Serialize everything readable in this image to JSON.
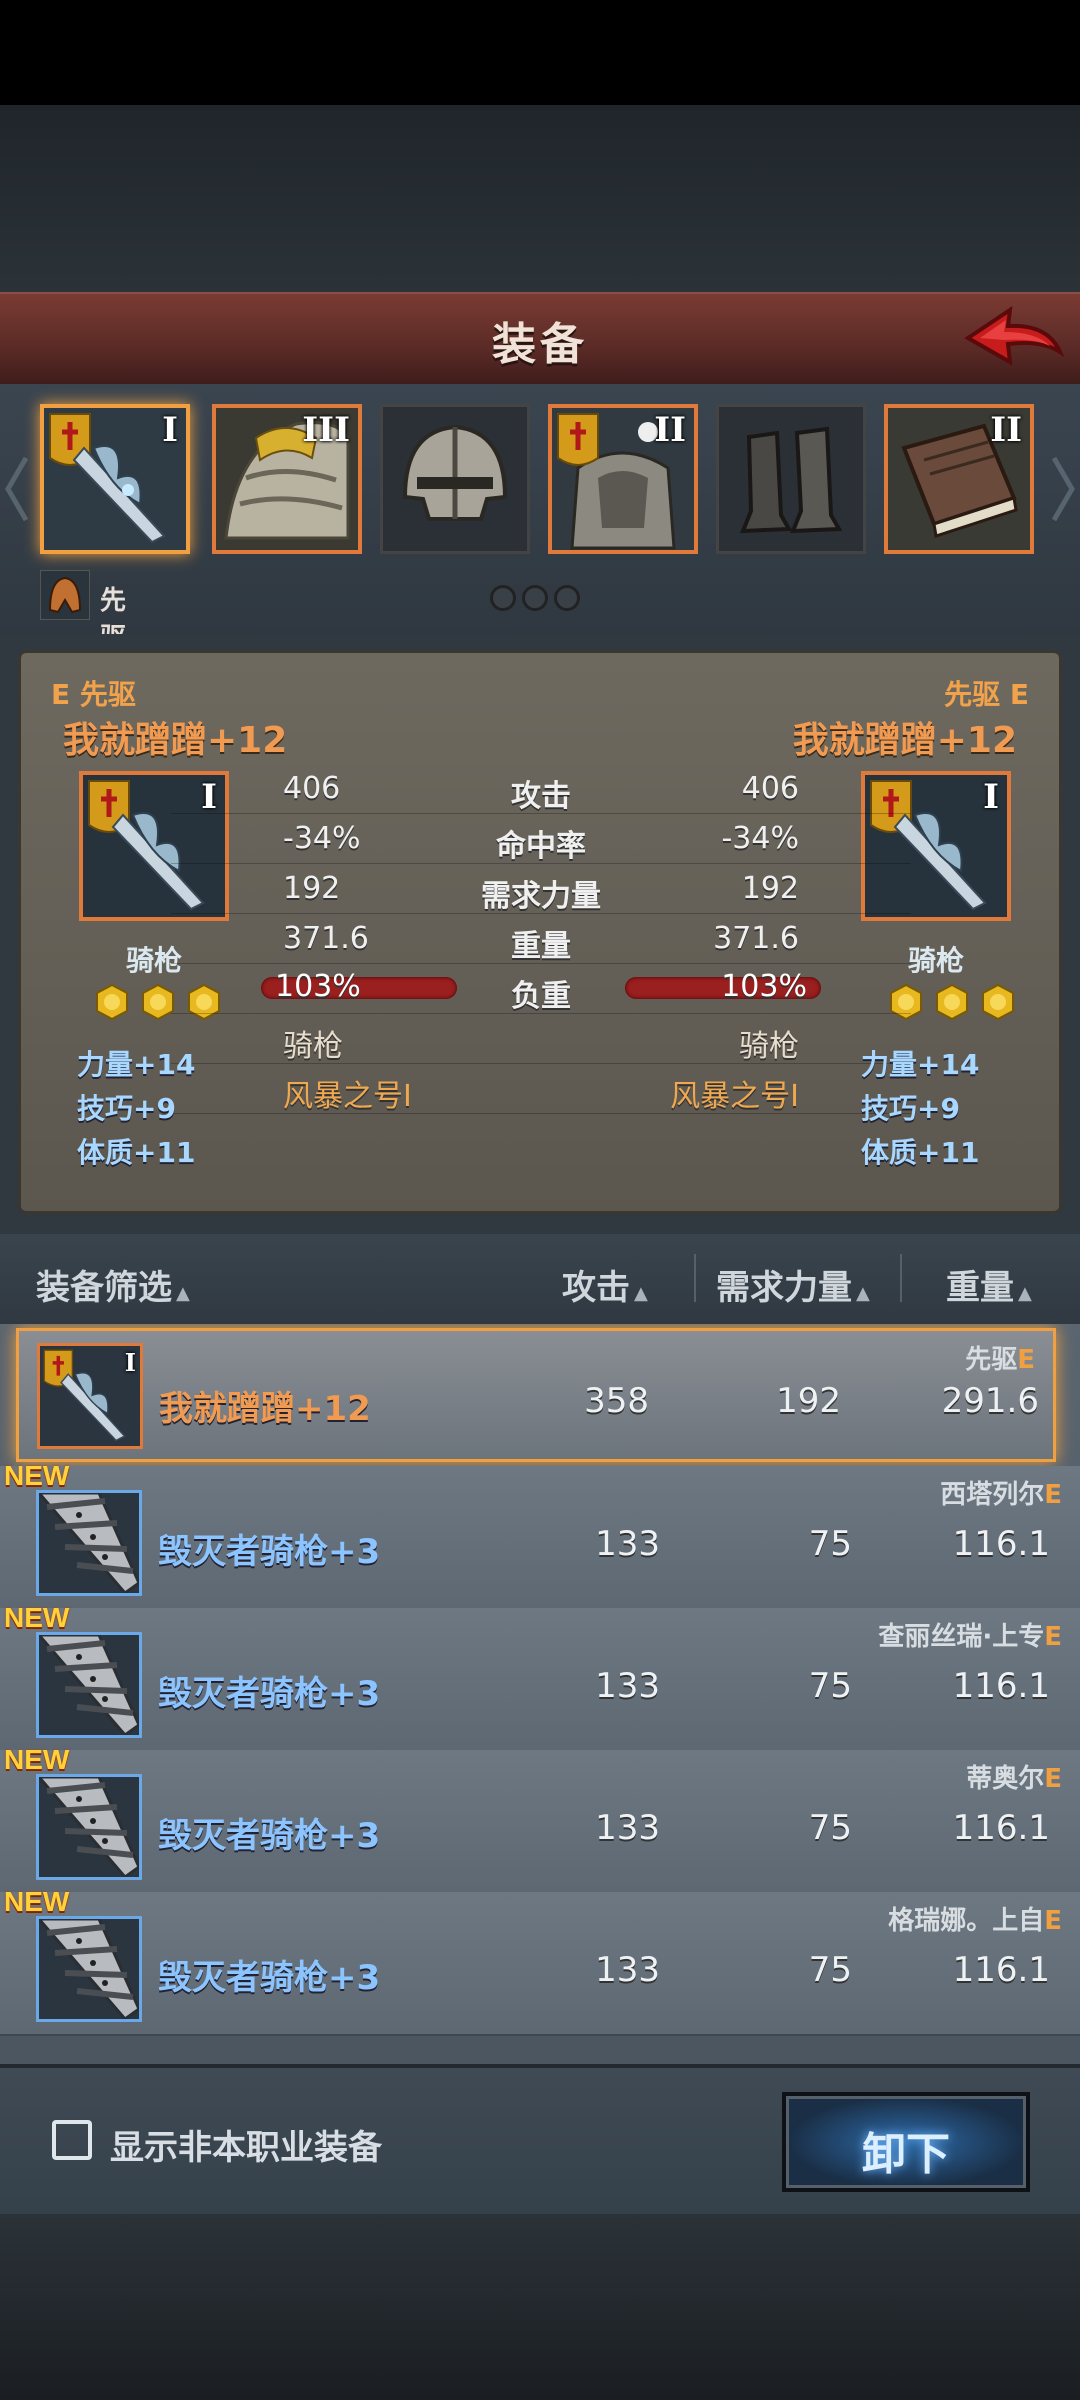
{
  "header": {
    "title": "装备"
  },
  "slots": [
    {
      "tier": "I",
      "selected": true
    },
    {
      "tier": "III",
      "selected": false
    },
    {
      "tier": "",
      "selected": false
    },
    {
      "tier": "II",
      "selected": false
    },
    {
      "tier": "",
      "selected": false
    },
    {
      "tier": "II",
      "selected": false
    }
  ],
  "character_class": "先驱",
  "compare": {
    "left": {
      "tag": "E 先驱",
      "name": "我就蹭蹭+12",
      "tier": "I",
      "type": "骑枪",
      "attack": "406",
      "hit_rate": "-34%",
      "str_req": "192",
      "weight": "371.6",
      "load": "103%",
      "subtype": "骑枪",
      "skill": "风暴之号I",
      "bonuses": [
        "力量+14",
        "技巧+9",
        "体质+11"
      ]
    },
    "right": {
      "tag": "先驱 E",
      "name": "我就蹭蹭+12",
      "tier": "I",
      "type": "骑枪",
      "attack": "406",
      "hit_rate": "-34%",
      "str_req": "192",
      "weight": "371.6",
      "load": "103%",
      "subtype": "骑枪",
      "skill": "风暴之号I",
      "bonuses": [
        "力量+14",
        "技巧+9",
        "体质+11"
      ]
    },
    "labels": {
      "attack": "攻击",
      "hit_rate": "命中率",
      "str_req": "需求力量",
      "weight": "重量",
      "load": "负重"
    },
    "stars": 3
  },
  "list_header": {
    "filter": "装备筛选",
    "attack": "攻击",
    "str_req": "需求力量",
    "weight": "重量"
  },
  "list": [
    {
      "owner": "先驱",
      "grade": "E",
      "name": "我就蹭蹭+12",
      "attack": "358",
      "str_req": "192",
      "weight": "291.6",
      "new": false,
      "selected": true,
      "tier": "I"
    },
    {
      "owner": "西塔列尔",
      "grade": "E",
      "name": "毁灭者骑枪+3",
      "attack": "133",
      "str_req": "75",
      "weight": "116.1",
      "new": true,
      "selected": false
    },
    {
      "owner": "查丽丝瑞·上专",
      "grade": "E",
      "name": "毁灭者骑枪+3",
      "attack": "133",
      "str_req": "75",
      "weight": "116.1",
      "new": true,
      "selected": false
    },
    {
      "owner": "蒂奥尔",
      "grade": "E",
      "name": "毁灭者骑枪+3",
      "attack": "133",
      "str_req": "75",
      "weight": "116.1",
      "new": true,
      "selected": false
    },
    {
      "owner": "格瑞娜。上自",
      "grade": "E",
      "name": "毁灭者骑枪+3",
      "attack": "133",
      "str_req": "75",
      "weight": "116.1",
      "new": true,
      "selected": false
    }
  ],
  "new_label": "NEW",
  "bottom": {
    "checkbox_label": "显示非本职业装备",
    "unequip_label": "卸下"
  },
  "colors": {
    "accent": "#f0a040",
    "item_orange": "#f09a52",
    "item_blue": "#8cc4ff",
    "header_red": "#6a3330"
  }
}
